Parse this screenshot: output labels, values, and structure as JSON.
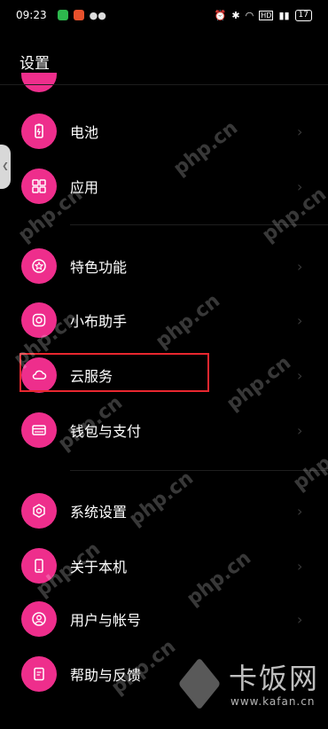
{
  "status_bar": {
    "time": "09:23",
    "battery": "17",
    "app_colors": [
      "#2db84d",
      "#e8512c",
      "#2aa64b"
    ]
  },
  "header": {
    "title": "设置"
  },
  "menu": {
    "items": [
      {
        "label": "电池",
        "icon": "battery-icon"
      },
      {
        "label": "应用",
        "icon": "apps-grid-icon"
      },
      {
        "label": "特色功能",
        "icon": "star-badge-icon"
      },
      {
        "label": "小布助手",
        "icon": "assistant-icon"
      },
      {
        "label": "云服务",
        "icon": "cloud-icon"
      },
      {
        "label": "钱包与支付",
        "icon": "wallet-icon"
      },
      {
        "label": "系统设置",
        "icon": "system-gear-icon"
      },
      {
        "label": "关于本机",
        "icon": "phone-icon"
      },
      {
        "label": "用户与帐号",
        "icon": "user-icon"
      },
      {
        "label": "帮助与反馈",
        "icon": "help-doc-icon"
      }
    ],
    "chevron": "›"
  },
  "watermark": {
    "text": "php.cn",
    "logo_text": "卡饭网",
    "logo_url": "www.kafan.cn"
  },
  "colors": {
    "accent": "#ee2e8c",
    "highlight": "#e8272f"
  }
}
